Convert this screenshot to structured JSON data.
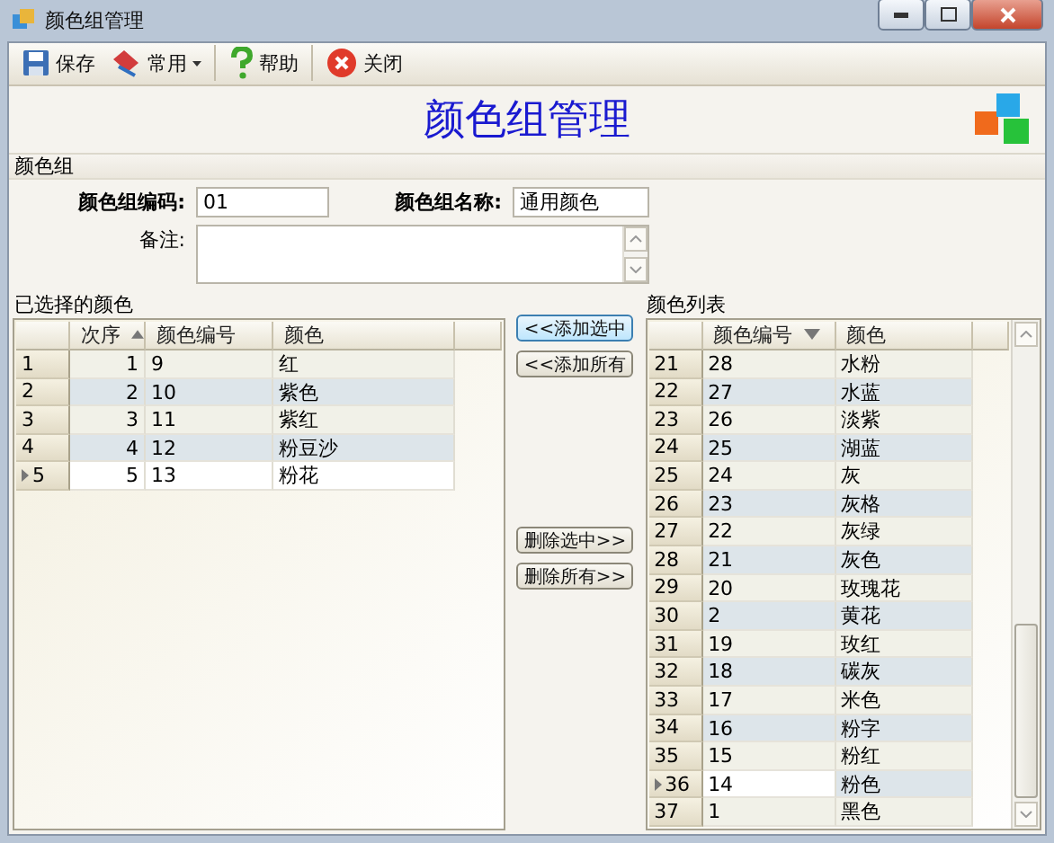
{
  "window": {
    "title": "颜色组管理"
  },
  "toolbar": [
    {
      "kind": "save",
      "label": "保存"
    },
    {
      "kind": "common",
      "label": "常用",
      "dropdown": true
    },
    {
      "kind": "help",
      "label": "帮助"
    },
    {
      "kind": "close",
      "label": "关闭"
    }
  ],
  "header": {
    "title": "颜色组管理"
  },
  "group": {
    "title": "颜色组",
    "code_label": "颜色组编码:",
    "code_value": "01",
    "name_label": "颜色组名称:",
    "name_value": "通用颜色",
    "note_label": "备注:"
  },
  "selected_colors": {
    "title": "已选择的颜色",
    "columns": [
      {
        "label": "次序",
        "sorted": true,
        "descending": false
      },
      {
        "label": "颜色编号",
        "sorted": false
      },
      {
        "label": "颜色",
        "sorted": false
      }
    ],
    "rows": [
      {
        "row": "1",
        "order": "1",
        "code": "9",
        "color_name": "红",
        "selected": false
      },
      {
        "row": "2",
        "order": "2",
        "code": "10",
        "color_name": "紫色",
        "selected": false
      },
      {
        "row": "3",
        "order": "3",
        "code": "11",
        "color_name": "紫红",
        "selected": false
      },
      {
        "row": "4",
        "order": "4",
        "code": "12",
        "color_name": "粉豆沙",
        "selected": false
      },
      {
        "row": "5",
        "order": "5",
        "code": "13",
        "color_name": "粉花",
        "selected": true
      }
    ]
  },
  "actions": [
    {
      "label": "<<添加选中",
      "focused": true
    },
    {
      "label": "<<添加所有",
      "focused": false
    },
    {
      "label": "删除选中>>",
      "focused": false
    },
    {
      "label": "删除所有>>",
      "focused": false
    }
  ],
  "color_list": {
    "title": "颜色列表",
    "columns": [
      {
        "label": "颜色编号",
        "sorted": true,
        "descending": true
      },
      {
        "label": "颜色",
        "sorted": false
      }
    ],
    "rows": [
      {
        "row": "21",
        "code": "28",
        "color_name": "水粉",
        "selected": false
      },
      {
        "row": "22",
        "code": "27",
        "color_name": "水蓝",
        "selected": false
      },
      {
        "row": "23",
        "code": "26",
        "color_name": "淡紫",
        "selected": false
      },
      {
        "row": "24",
        "code": "25",
        "color_name": "湖蓝",
        "selected": false
      },
      {
        "row": "25",
        "code": "24",
        "color_name": "灰",
        "selected": false
      },
      {
        "row": "26",
        "code": "23",
        "color_name": "灰格",
        "selected": false
      },
      {
        "row": "27",
        "code": "22",
        "color_name": "灰绿",
        "selected": false
      },
      {
        "row": "28",
        "code": "21",
        "color_name": "灰色",
        "selected": false
      },
      {
        "row": "29",
        "code": "20",
        "color_name": "玫瑰花",
        "selected": false
      },
      {
        "row": "30",
        "code": "2",
        "color_name": "黄花",
        "selected": false
      },
      {
        "row": "31",
        "code": "19",
        "color_name": "玫红",
        "selected": false
      },
      {
        "row": "32",
        "code": "18",
        "color_name": "碳灰",
        "selected": false
      },
      {
        "row": "33",
        "code": "17",
        "color_name": "米色",
        "selected": false
      },
      {
        "row": "34",
        "code": "16",
        "color_name": "粉字",
        "selected": false
      },
      {
        "row": "35",
        "code": "15",
        "color_name": "粉红",
        "selected": false
      },
      {
        "row": "36",
        "code": "14",
        "color_name": "粉色",
        "selected": true
      },
      {
        "row": "37",
        "code": "1",
        "color_name": "黑色",
        "selected": false
      }
    ]
  }
}
